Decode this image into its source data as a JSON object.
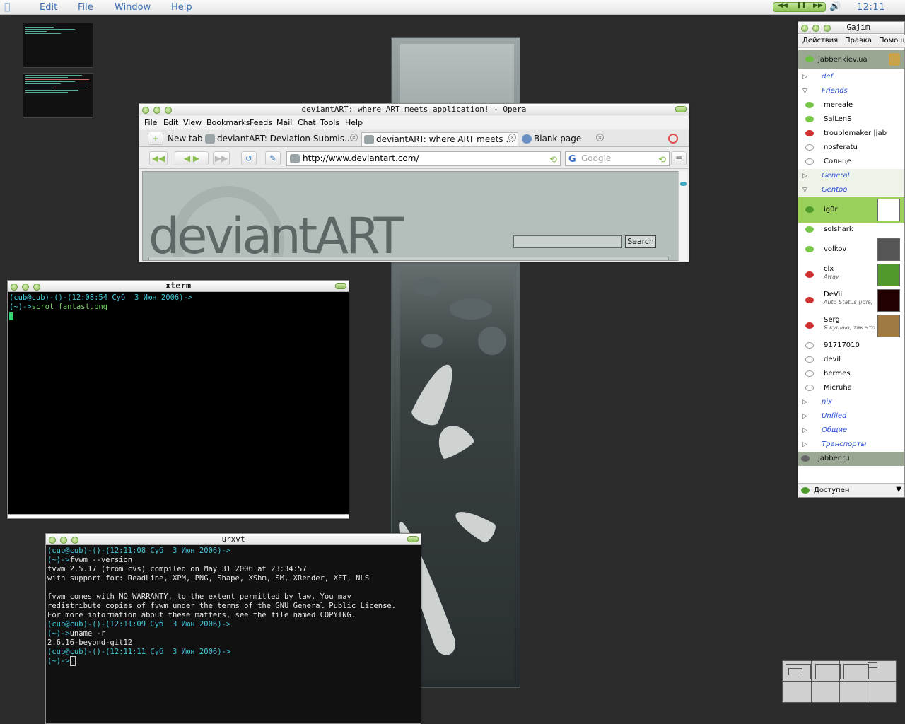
{
  "menubar": {
    "items": [
      "Edit",
      "File",
      "Window",
      "Help"
    ],
    "clock": "12:11"
  },
  "opera": {
    "title": "deviantART: where ART meets application! - Opera",
    "menu": [
      "File",
      "Edit",
      "View",
      "Bookmarks",
      "Feeds",
      "Mail",
      "Chat",
      "Tools",
      "Help"
    ],
    "tabs": [
      "New tab",
      "deviantART: Deviation Submis...",
      "deviantART: where ART meets ...",
      "Blank page"
    ],
    "url": "http://www.deviantart.com/",
    "search_placeholder": "Google",
    "page": {
      "logo": "deviantART",
      "search_button": "Search"
    }
  },
  "xterm": {
    "title": "xterm",
    "lines": [
      {
        "prompt": "(cub@cub)-()-(12:08:54 Суб  3 Июн 2006)->",
        "cmd": ""
      },
      {
        "prompt": "(~)->",
        "cmd": "scrot fantast.png"
      }
    ]
  },
  "urxvt": {
    "title": "urxvt",
    "l1": "(cub@cub)-()-(12:11:08 Суб  3 Июн 2006)->",
    "l2p": "(~)->",
    "l2c": "fvwm --version",
    "l3": "fvwm 2.5.17 (from cvs) compiled on May 31 2006 at 23:34:57",
    "l4": "with support for: ReadLine, XPM, PNG, Shape, XShm, SM, XRender, XFT, NLS",
    "l5": "",
    "l6": "fvwm comes with NO WARRANTY, to the extent permitted by law. You may",
    "l7": "redistribute copies of fvwm under the terms of the GNU General Public License.",
    "l8": "For more information about these matters, see the file named COPYING.",
    "l9": "(cub@cub)-()-(12:11:09 Суб  3 Июн 2006)->",
    "l10p": "(~)->",
    "l10c": "uname -r",
    "l11": "2.6.16-beyond-git12",
    "l12": "(cub@cub)-()-(12:11:11 Суб  3 Июн 2006)->",
    "l13p": "(~)->"
  },
  "gajim": {
    "title": "Gajim",
    "menu": [
      "Действия",
      "Правка",
      "Помощь"
    ],
    "account1": "jabber.kiev.ua",
    "groups": {
      "def": "def",
      "friends": "Friends",
      "general": "General",
      "gentoo": "Gentoo",
      "nix": "nix",
      "unfiled": "Unfiled",
      "common": "Общие",
      "transports": "Транспорты"
    },
    "friends": [
      "mereale",
      "SalLenS",
      "troublemaker |jab",
      "nosferatu",
      "Солнце"
    ],
    "gentoo": {
      "ig0r": "ig0r",
      "solshark": "solshark",
      "volkov": "volkov",
      "clx": "clx",
      "clx_status": "Away",
      "devil": "DeViL",
      "devil_status": "Auto Status (idle)",
      "serg": "Serg",
      "serg_status": "Я кушаю, так что обс",
      "n1": "91717010",
      "n2": "devil",
      "n3": "hermes",
      "n4": "Micruha"
    },
    "account2": "jabber.ru",
    "status": "Доступен"
  }
}
